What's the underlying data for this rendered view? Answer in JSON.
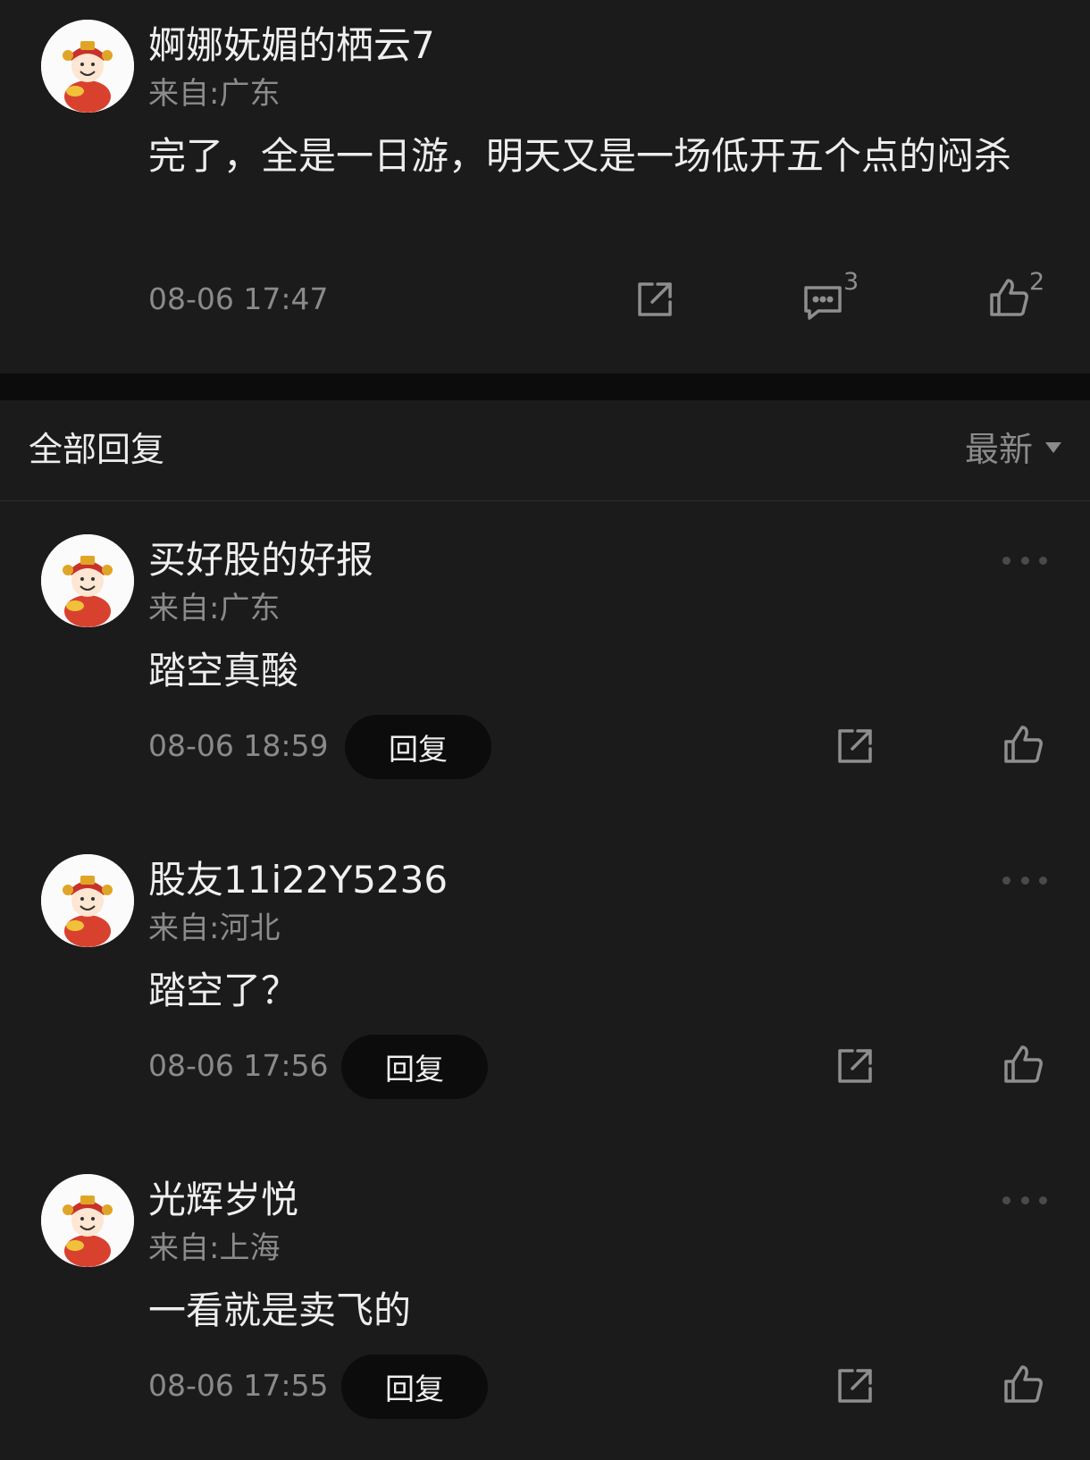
{
  "post": {
    "username": "婀娜妩媚的栖云7",
    "location": "来自:广东",
    "content": "完了，全是一日游，明天又是一场低开五个点的闷杀",
    "time": "08-06 17:47",
    "comment_count": "3",
    "like_count": "2",
    "icons": [
      "avatar",
      "share-icon",
      "comment-icon",
      "like-icon"
    ]
  },
  "replies_header": {
    "title": "全部回复",
    "sort_label": "最新"
  },
  "replies": [
    {
      "username": "买好股的好报",
      "location": "来自:广东",
      "content": "踏空真酸",
      "time": "08-06 18:59",
      "reply_label": "回复"
    },
    {
      "username": "股友11i22Y5236",
      "location": "来自:河北",
      "content": "踏空了？",
      "time": "08-06 17:56",
      "reply_label": "回复"
    },
    {
      "username": "光辉岁悦",
      "location": "来自:上海",
      "content": "一看就是卖飞的",
      "time": "08-06 17:55",
      "reply_label": "回复"
    }
  ],
  "colors": {
    "background": "#1b1b1b",
    "divider": "#0c0c0c",
    "muted_text": "#8b8b8b"
  }
}
